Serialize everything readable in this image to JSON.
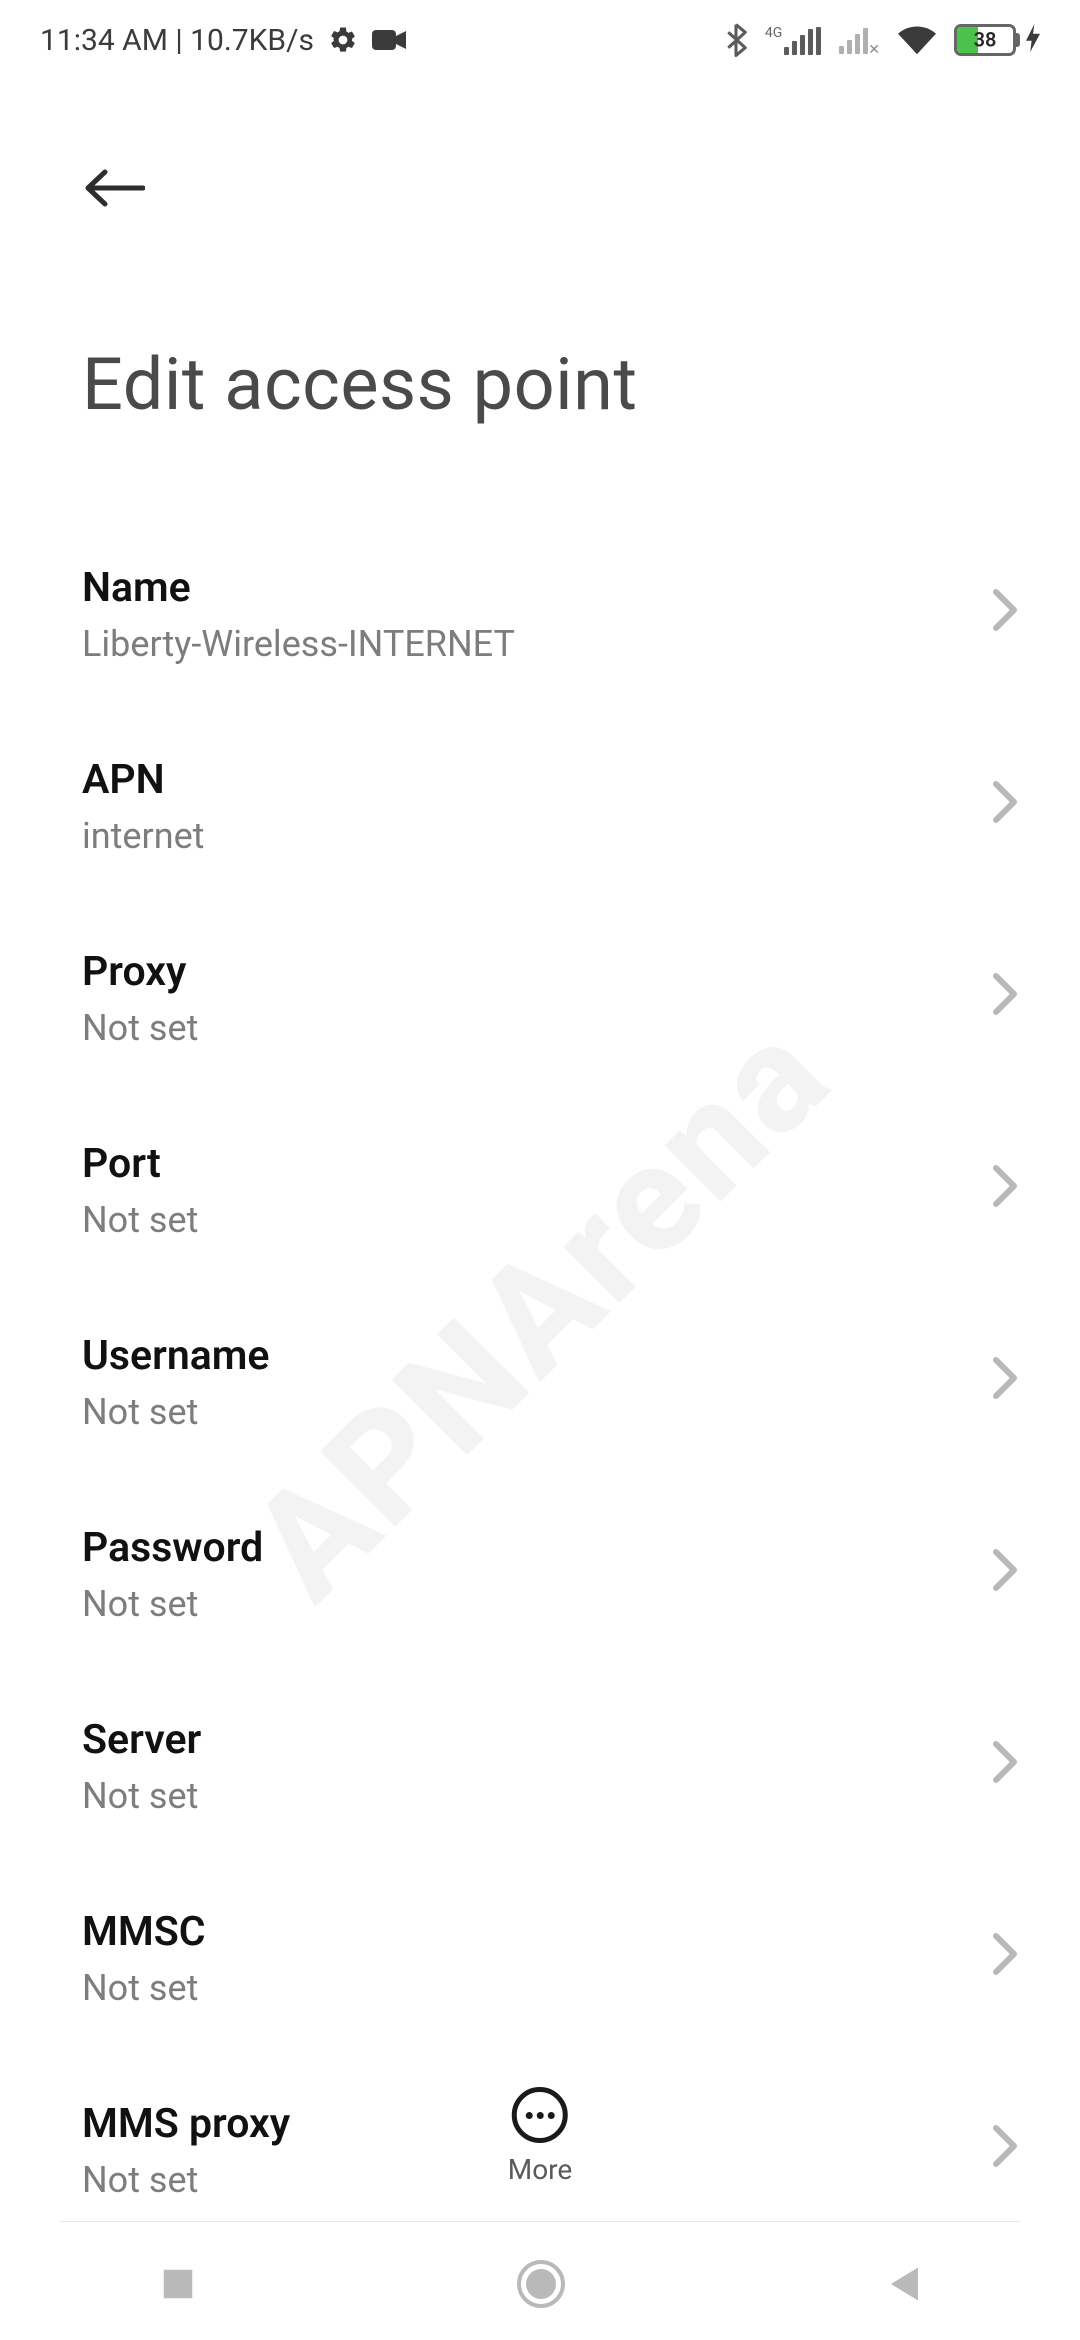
{
  "status": {
    "time_text": "11:34 AM | 10.7KB/s",
    "net_label": "4G",
    "battery_pct": "38"
  },
  "header": {
    "title": "Edit access point"
  },
  "rows": [
    {
      "label": "Name",
      "value": "Liberty-Wireless-INTERNET"
    },
    {
      "label": "APN",
      "value": "internet"
    },
    {
      "label": "Proxy",
      "value": "Not set"
    },
    {
      "label": "Port",
      "value": "Not set"
    },
    {
      "label": "Username",
      "value": "Not set"
    },
    {
      "label": "Password",
      "value": "Not set"
    },
    {
      "label": "Server",
      "value": "Not set"
    },
    {
      "label": "MMSC",
      "value": "Not set"
    },
    {
      "label": "MMS proxy",
      "value": "Not set"
    }
  ],
  "more": {
    "label": "More"
  },
  "watermark": "APNArena"
}
